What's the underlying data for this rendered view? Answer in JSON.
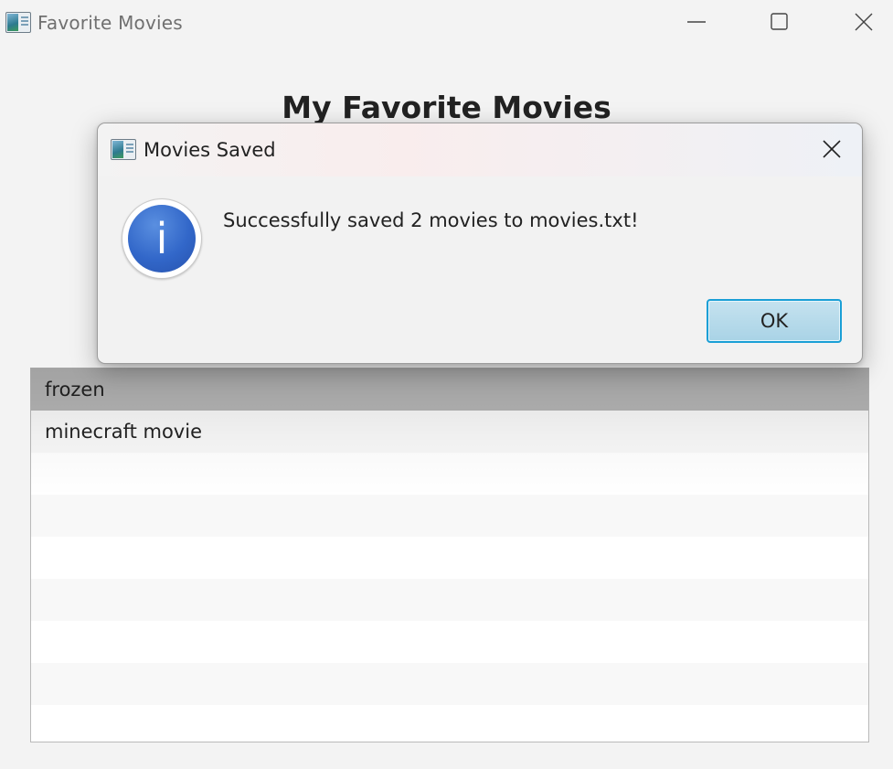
{
  "window": {
    "title": "Favorite Movies",
    "icon": "java-app-icon",
    "controls": [
      "minimize-icon",
      "maximize-icon",
      "close-icon"
    ]
  },
  "main": {
    "heading": "My Favorite Movies",
    "movies": [
      "frozen",
      "minecraft movie"
    ]
  },
  "dialog": {
    "title": "Movies Saved",
    "icon": "info-icon",
    "message": "Successfully saved 2 movies to movies.txt!",
    "ok_label": "OK",
    "info_glyph": "i"
  },
  "colors": {
    "accent": "#1a9fd6",
    "info_blue": "#3267c9",
    "selected_row": "#b5b5b5"
  }
}
